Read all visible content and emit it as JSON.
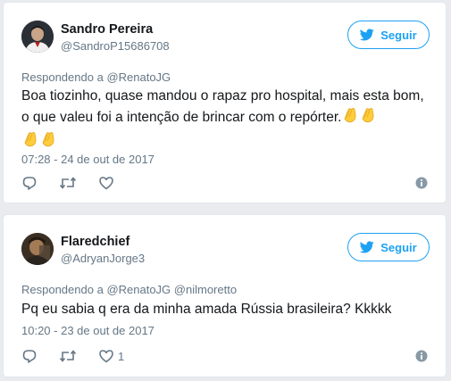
{
  "tweets": [
    {
      "name": "Sandro Pereira",
      "handle": "@SandroP15686708",
      "follow_label": "Seguir",
      "replying_prefix": "Respondendo a",
      "replying_to": [
        "@RenatoJG"
      ],
      "text": "Boa tiozinho, quase mandou o rapaz pro hospital, mais esta bom, o que valeu foi a intenção de brincar com o repórter.",
      "emojis": [
        "clapping-hands",
        "clapping-hands",
        "clapping-hands",
        "clapping-hands"
      ],
      "timestamp": "07:28 - 24 de out de 2017",
      "like_count": ""
    },
    {
      "name": "Flaredchief",
      "handle": "@AdryanJorge3",
      "follow_label": "Seguir",
      "replying_prefix": "Respondendo a",
      "replying_to": [
        "@RenatoJG",
        "@nilmoretto"
      ],
      "text": "Pq eu sabia q era da minha amada Rússia brasileira? Kkkkk",
      "emojis": [],
      "timestamp": "10:20 - 23 de out de 2017",
      "like_count": "1"
    }
  ],
  "icons": {
    "follow": "twitter-bird-icon",
    "reply": "reply-icon",
    "retweet": "retweet-icon",
    "like": "heart-icon",
    "info": "info-icon"
  },
  "colors": {
    "accent": "#1da1f2",
    "secondary_text": "#657786",
    "primary_text": "#14171a",
    "card_border": "#e1e8ed",
    "background": "#e9ebee"
  }
}
